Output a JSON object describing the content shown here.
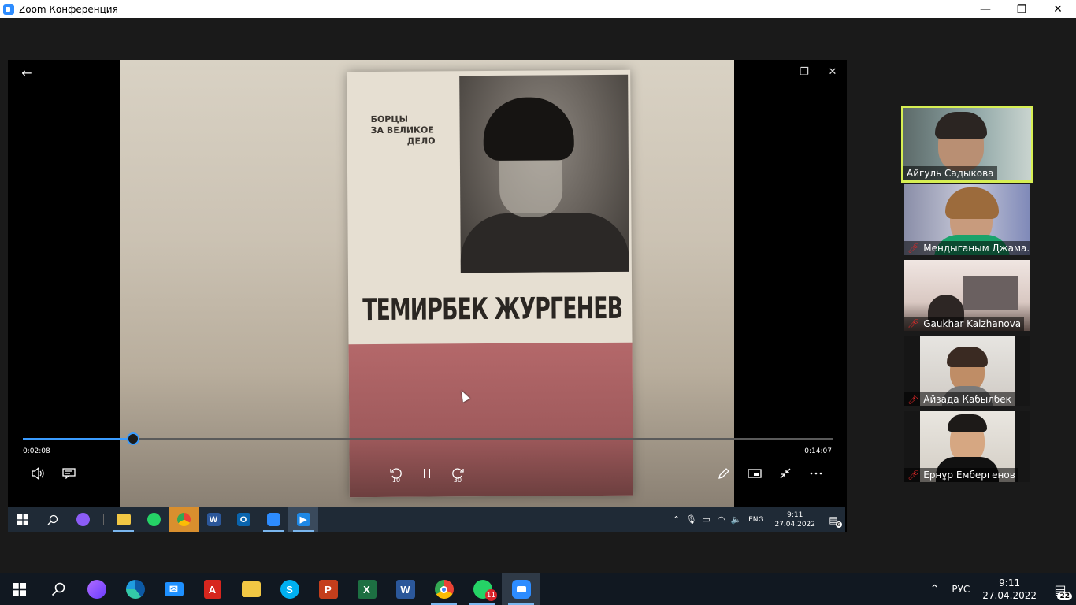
{
  "window": {
    "title": "Zoom Конференция",
    "minimize": "—",
    "restore": "❐",
    "close": "✕"
  },
  "shared_screen": {
    "video": {
      "book_series": [
        "БОРЦЫ",
        "ЗА ВЕЛИКОЕ",
        "ДЕЛО"
      ],
      "book_title": "ТЕМИРБЕК ЖУРГЕНЕВ"
    },
    "player": {
      "current_time": "0:02:08",
      "total_time": "0:14:07",
      "progress_fraction": 0.1364,
      "skip_back_seconds": "10",
      "skip_forward_seconds": "30"
    },
    "inner_taskbar": {
      "language": "ENG",
      "time": "9:11",
      "date": "27.04.2022",
      "notification_count": "6"
    }
  },
  "participants": [
    {
      "name": "Айгуль Садыкова",
      "muted": false,
      "active_speaker": true
    },
    {
      "name": "Мендыганым Джама...",
      "muted": true,
      "active_speaker": false
    },
    {
      "name": "Gaukhar Kalzhanova",
      "muted": true,
      "active_speaker": false
    },
    {
      "name": "Айзада Кабылбек",
      "muted": true,
      "active_speaker": false
    },
    {
      "name": "Ернұр Ембергенов",
      "muted": true,
      "active_speaker": false
    }
  ],
  "taskbar": {
    "language": "РУС",
    "time": "9:11",
    "date": "27.04.2022",
    "notification_count": "22",
    "whatsapp_badge": "11"
  },
  "colors": {
    "active_speaker_border": "#d7ef53",
    "progress_accent": "#3b9cff",
    "muted_icon": "#e02828"
  }
}
